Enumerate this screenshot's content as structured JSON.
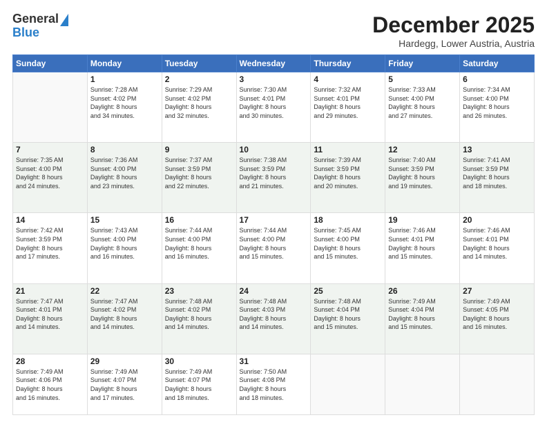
{
  "logo": {
    "general": "General",
    "blue": "Blue"
  },
  "header": {
    "month": "December 2025",
    "location": "Hardegg, Lower Austria, Austria"
  },
  "weekdays": [
    "Sunday",
    "Monday",
    "Tuesday",
    "Wednesday",
    "Thursday",
    "Friday",
    "Saturday"
  ],
  "weeks": [
    [
      {
        "day": "",
        "info": ""
      },
      {
        "day": "1",
        "info": "Sunrise: 7:28 AM\nSunset: 4:02 PM\nDaylight: 8 hours\nand 34 minutes."
      },
      {
        "day": "2",
        "info": "Sunrise: 7:29 AM\nSunset: 4:02 PM\nDaylight: 8 hours\nand 32 minutes."
      },
      {
        "day": "3",
        "info": "Sunrise: 7:30 AM\nSunset: 4:01 PM\nDaylight: 8 hours\nand 30 minutes."
      },
      {
        "day": "4",
        "info": "Sunrise: 7:32 AM\nSunset: 4:01 PM\nDaylight: 8 hours\nand 29 minutes."
      },
      {
        "day": "5",
        "info": "Sunrise: 7:33 AM\nSunset: 4:00 PM\nDaylight: 8 hours\nand 27 minutes."
      },
      {
        "day": "6",
        "info": "Sunrise: 7:34 AM\nSunset: 4:00 PM\nDaylight: 8 hours\nand 26 minutes."
      }
    ],
    [
      {
        "day": "7",
        "info": "Sunrise: 7:35 AM\nSunset: 4:00 PM\nDaylight: 8 hours\nand 24 minutes."
      },
      {
        "day": "8",
        "info": "Sunrise: 7:36 AM\nSunset: 4:00 PM\nDaylight: 8 hours\nand 23 minutes."
      },
      {
        "day": "9",
        "info": "Sunrise: 7:37 AM\nSunset: 3:59 PM\nDaylight: 8 hours\nand 22 minutes."
      },
      {
        "day": "10",
        "info": "Sunrise: 7:38 AM\nSunset: 3:59 PM\nDaylight: 8 hours\nand 21 minutes."
      },
      {
        "day": "11",
        "info": "Sunrise: 7:39 AM\nSunset: 3:59 PM\nDaylight: 8 hours\nand 20 minutes."
      },
      {
        "day": "12",
        "info": "Sunrise: 7:40 AM\nSunset: 3:59 PM\nDaylight: 8 hours\nand 19 minutes."
      },
      {
        "day": "13",
        "info": "Sunrise: 7:41 AM\nSunset: 3:59 PM\nDaylight: 8 hours\nand 18 minutes."
      }
    ],
    [
      {
        "day": "14",
        "info": "Sunrise: 7:42 AM\nSunset: 3:59 PM\nDaylight: 8 hours\nand 17 minutes."
      },
      {
        "day": "15",
        "info": "Sunrise: 7:43 AM\nSunset: 4:00 PM\nDaylight: 8 hours\nand 16 minutes."
      },
      {
        "day": "16",
        "info": "Sunrise: 7:44 AM\nSunset: 4:00 PM\nDaylight: 8 hours\nand 16 minutes."
      },
      {
        "day": "17",
        "info": "Sunrise: 7:44 AM\nSunset: 4:00 PM\nDaylight: 8 hours\nand 15 minutes."
      },
      {
        "day": "18",
        "info": "Sunrise: 7:45 AM\nSunset: 4:00 PM\nDaylight: 8 hours\nand 15 minutes."
      },
      {
        "day": "19",
        "info": "Sunrise: 7:46 AM\nSunset: 4:01 PM\nDaylight: 8 hours\nand 15 minutes."
      },
      {
        "day": "20",
        "info": "Sunrise: 7:46 AM\nSunset: 4:01 PM\nDaylight: 8 hours\nand 14 minutes."
      }
    ],
    [
      {
        "day": "21",
        "info": "Sunrise: 7:47 AM\nSunset: 4:01 PM\nDaylight: 8 hours\nand 14 minutes."
      },
      {
        "day": "22",
        "info": "Sunrise: 7:47 AM\nSunset: 4:02 PM\nDaylight: 8 hours\nand 14 minutes."
      },
      {
        "day": "23",
        "info": "Sunrise: 7:48 AM\nSunset: 4:02 PM\nDaylight: 8 hours\nand 14 minutes."
      },
      {
        "day": "24",
        "info": "Sunrise: 7:48 AM\nSunset: 4:03 PM\nDaylight: 8 hours\nand 14 minutes."
      },
      {
        "day": "25",
        "info": "Sunrise: 7:48 AM\nSunset: 4:04 PM\nDaylight: 8 hours\nand 15 minutes."
      },
      {
        "day": "26",
        "info": "Sunrise: 7:49 AM\nSunset: 4:04 PM\nDaylight: 8 hours\nand 15 minutes."
      },
      {
        "day": "27",
        "info": "Sunrise: 7:49 AM\nSunset: 4:05 PM\nDaylight: 8 hours\nand 16 minutes."
      }
    ],
    [
      {
        "day": "28",
        "info": "Sunrise: 7:49 AM\nSunset: 4:06 PM\nDaylight: 8 hours\nand 16 minutes."
      },
      {
        "day": "29",
        "info": "Sunrise: 7:49 AM\nSunset: 4:07 PM\nDaylight: 8 hours\nand 17 minutes."
      },
      {
        "day": "30",
        "info": "Sunrise: 7:49 AM\nSunset: 4:07 PM\nDaylight: 8 hours\nand 18 minutes."
      },
      {
        "day": "31",
        "info": "Sunrise: 7:50 AM\nSunset: 4:08 PM\nDaylight: 8 hours\nand 18 minutes."
      },
      {
        "day": "",
        "info": ""
      },
      {
        "day": "",
        "info": ""
      },
      {
        "day": "",
        "info": ""
      }
    ]
  ]
}
